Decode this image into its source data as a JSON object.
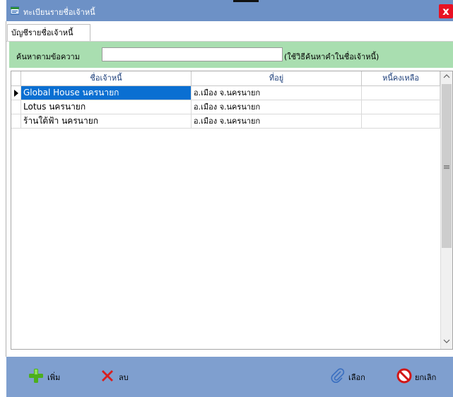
{
  "window": {
    "title": "ทะเบียนรายชื่อเจ้าหนี้",
    "close_symbol": "x"
  },
  "tab": {
    "label": "บัญชีรายชื่อเจ้าหนี้"
  },
  "search": {
    "label": "ค้นหาตามข้อความ",
    "value": "",
    "hint": "(ใช้วิธีค้นหาคำในชื่อเจ้าหนี้)"
  },
  "grid": {
    "columns": [
      "ชื่อเจ้าหนี้",
      "ที่อยู่",
      "หนี้คงเหลือ"
    ],
    "rows": [
      {
        "name": "Global House นครนายก",
        "address": "อ.เมือง จ.นครนายก",
        "balance": "",
        "selected": true
      },
      {
        "name": "Lotus นครนายก",
        "address": "อ.เมือง จ.นครนายก",
        "balance": "",
        "selected": false
      },
      {
        "name": "ร้านใต้ฟ้า นครนายก",
        "address": "อ.เมือง จ.นครนายก",
        "balance": "",
        "selected": false
      }
    ]
  },
  "toolbar": {
    "add_label": "เพิ่ม",
    "delete_label": "ลบ",
    "select_label": "เลือก",
    "cancel_label": "ยกเลิก"
  },
  "icons": {
    "add": "plus-icon",
    "delete": "x-icon",
    "select": "paperclip-icon",
    "cancel": "no-entry-icon",
    "app": "app-window-icon"
  },
  "colors": {
    "titlebar": "#6d91c6",
    "close": "#e81123",
    "search_bar": "#a9deb0",
    "selection": "#0a6fd2",
    "bottombar": "#7f9fcf",
    "header_text": "#1d3f7a"
  }
}
